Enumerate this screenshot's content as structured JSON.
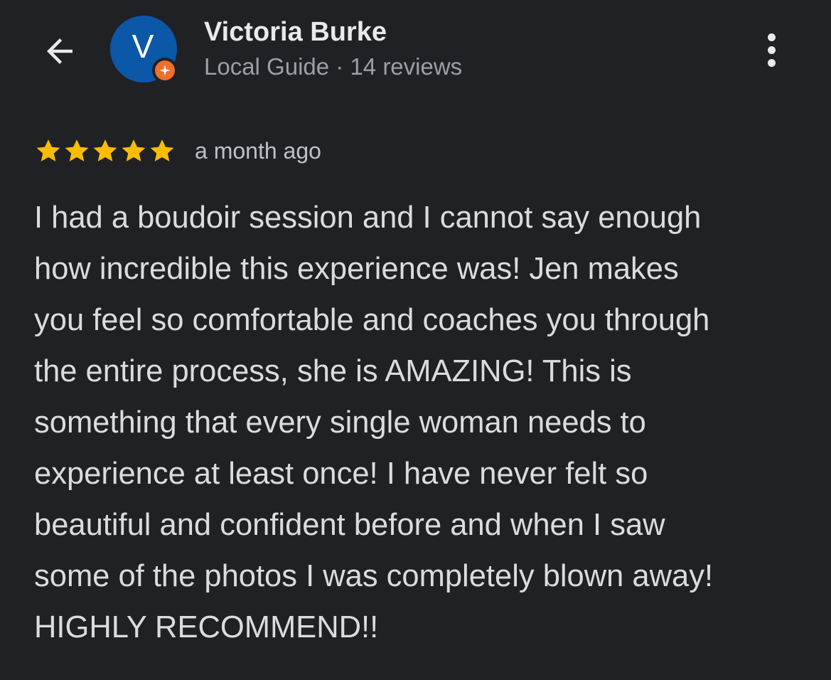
{
  "reviewer": {
    "name": "Victoria Burke",
    "avatar_letter": "V",
    "avatar_color": "#0b57a8",
    "badge_color": "#f0702a",
    "meta": "Local Guide · 14 reviews"
  },
  "toolbar": {
    "back_icon": "arrow-left-icon",
    "more_icon": "more-vertical-icon"
  },
  "review": {
    "rating": 5,
    "rating_max": 5,
    "star_color": "#fbbc04",
    "timestamp": "a month ago",
    "text": "I had a boudoir session and I cannot say enough\nhow incredible this experience was! Jen makes\nyou feel so comfortable and coaches you through\nthe entire process, she is AMAZING! This is\nsomething that every single woman needs to\nexperience at least once! I have never felt so\nbeautiful and confident before and when I saw\nsome of the photos I was completely blown away!\nHIGHLY RECOMMEND!!"
  }
}
